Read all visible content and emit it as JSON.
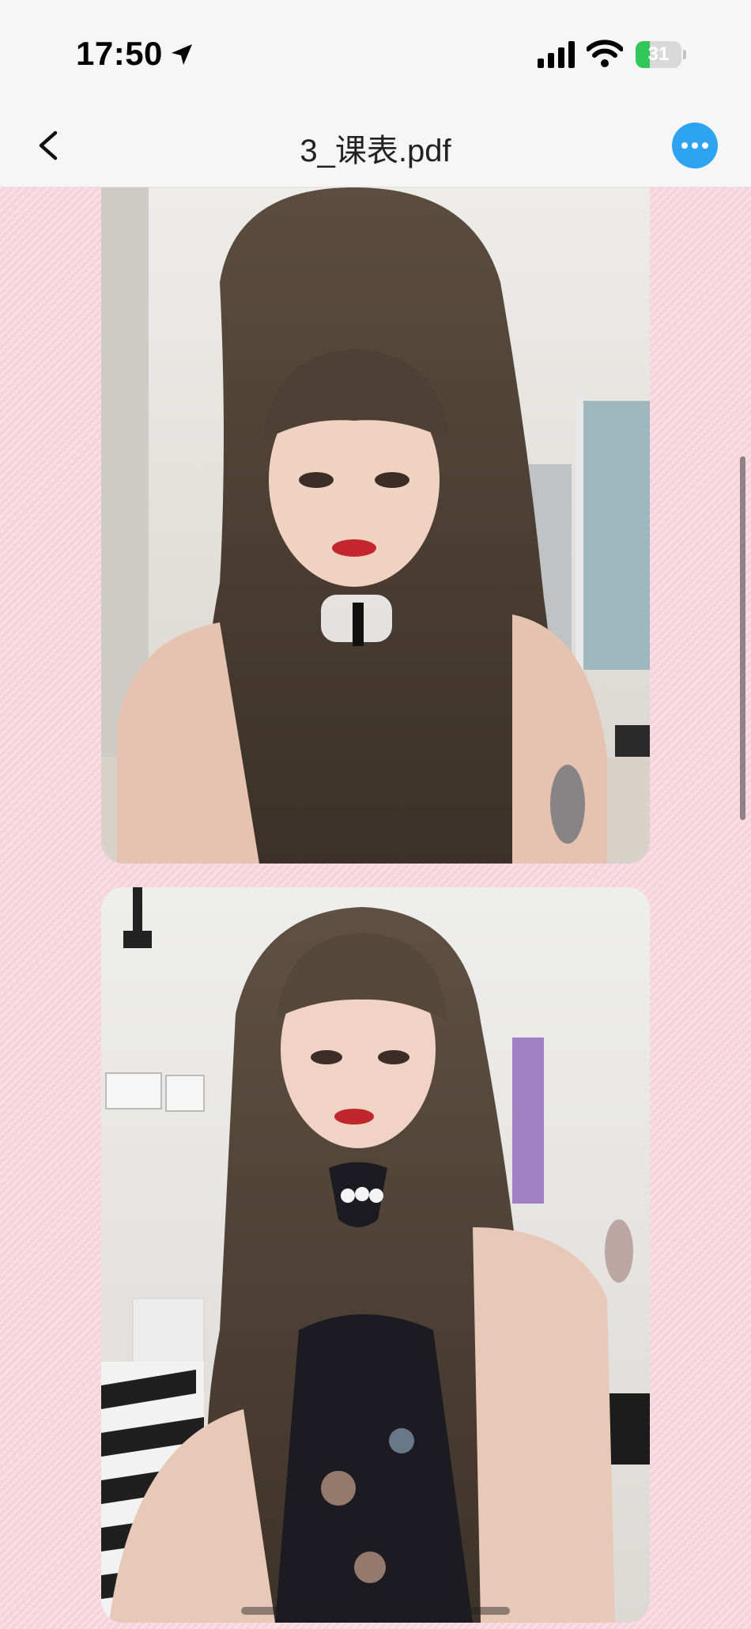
{
  "status_bar": {
    "time": "17:50",
    "battery_level": 31,
    "battery_text": "31",
    "icons": [
      "location-arrow-icon",
      "cellular-signal-icon",
      "wifi-icon",
      "battery-charging-icon"
    ]
  },
  "nav": {
    "title": "3_课表.pdf",
    "back_icon": "chevron-left-icon",
    "more_icon": "ellipsis-icon"
  },
  "colors": {
    "accent": "#2ea3f2",
    "viewer_background": "#f7d3de",
    "battery_fill": "#33c759"
  },
  "document": {
    "pages": [
      {
        "content": "photo"
      },
      {
        "content": "photo"
      }
    ]
  }
}
